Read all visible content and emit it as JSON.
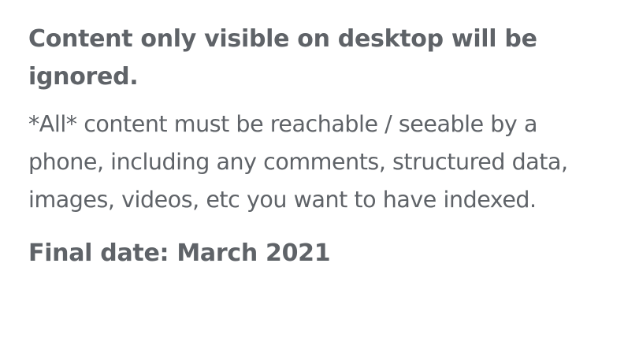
{
  "document": {
    "heading": "Content only visible on desktop will be ignored.",
    "body": "*All* content must be reachable / seeable by a phone, including any comments, structured data, images, videos, etc you want to have indexed.",
    "final_date": "Final date: March 2021"
  }
}
